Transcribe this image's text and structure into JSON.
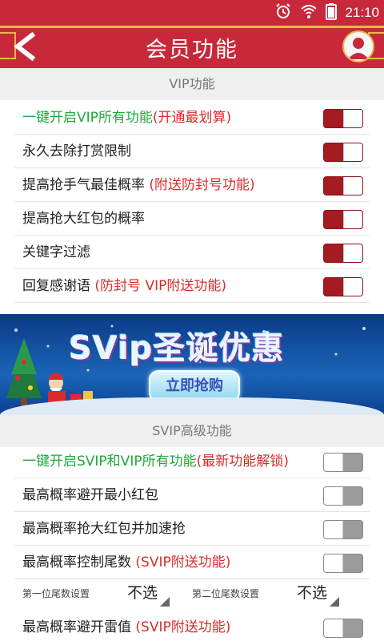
{
  "status_bar": {
    "time": "21:10",
    "icons": [
      "alarm-icon",
      "wifi-icon",
      "battery-icon"
    ]
  },
  "header": {
    "title": "会员功能"
  },
  "vip_section": {
    "title": "VIP功能",
    "items": [
      {
        "parts": [
          {
            "text": "一键开启VIP所有功能",
            "color": "green"
          },
          {
            "text": "(开通最划算)",
            "color": "red"
          }
        ],
        "enabled": true
      },
      {
        "parts": [
          {
            "text": "永久去除打赏限制",
            "color": ""
          }
        ],
        "enabled": true
      },
      {
        "parts": [
          {
            "text": "提高抢手气最佳概率 ",
            "color": ""
          },
          {
            "text": "(附送防封号功能)",
            "color": "red"
          }
        ],
        "enabled": true
      },
      {
        "parts": [
          {
            "text": "提高抢大红包的概率",
            "color": ""
          }
        ],
        "enabled": true
      },
      {
        "parts": [
          {
            "text": "关键字过滤",
            "color": ""
          }
        ],
        "enabled": true
      },
      {
        "parts": [
          {
            "text": "回复感谢语 ",
            "color": ""
          },
          {
            "text": "(防封号 VIP附送功能)",
            "color": "red"
          }
        ],
        "enabled": true
      }
    ]
  },
  "banner": {
    "title": "SVip圣诞优惠",
    "button_label": "立即抢购"
  },
  "svip_section": {
    "title": "SVIP高级功能",
    "items": [
      {
        "parts": [
          {
            "text": "一键开启SVIP和VIP所有功能",
            "color": "green"
          },
          {
            "text": "(最新功能解锁)",
            "color": "red"
          }
        ],
        "enabled": false
      },
      {
        "parts": [
          {
            "text": "最高概率避开最小红包",
            "color": ""
          }
        ],
        "enabled": false
      },
      {
        "parts": [
          {
            "text": "最高概率抢大红包并加速抢",
            "color": ""
          }
        ],
        "enabled": false
      },
      {
        "parts": [
          {
            "text": "最高概率控制尾数  ",
            "color": ""
          },
          {
            "text": "(SVIP附送功能)",
            "color": "red"
          }
        ],
        "enabled": false
      },
      {
        "parts": [
          {
            "text": "最高概率避开雷值  ",
            "color": ""
          },
          {
            "text": "(SVIP附送功能)",
            "color": "red"
          }
        ],
        "enabled": false
      }
    ],
    "tail_selects": [
      {
        "label": "第一位尾数设置",
        "value": "不选"
      },
      {
        "label": "第二位尾数设置",
        "value": "不选"
      }
    ]
  },
  "colors": {
    "brand_red": "#c7283a",
    "toggle_on": "#a61a22",
    "toggle_off": "#9b9b9b",
    "green_text": "#1fa83b",
    "red_text": "#d82c2c"
  }
}
